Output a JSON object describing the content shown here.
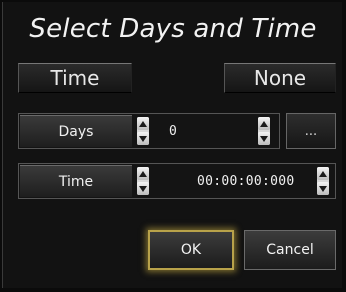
{
  "dialog": {
    "title": "Select Days and Time"
  },
  "mode_buttons": {
    "time_label": "Time",
    "none_label": "None"
  },
  "days_row": {
    "label": "Days",
    "value": "0",
    "more_label": "..."
  },
  "time_row": {
    "label": "Time",
    "value": "00:00:00:000"
  },
  "actions": {
    "ok_label": "OK",
    "cancel_label": "Cancel"
  },
  "colors": {
    "background": "#121212",
    "focus_glow": "#b8a24a",
    "text": "#f0f0f0"
  },
  "icons": {
    "spin_up": "triangle-up-icon",
    "spin_down": "triangle-down-icon"
  }
}
